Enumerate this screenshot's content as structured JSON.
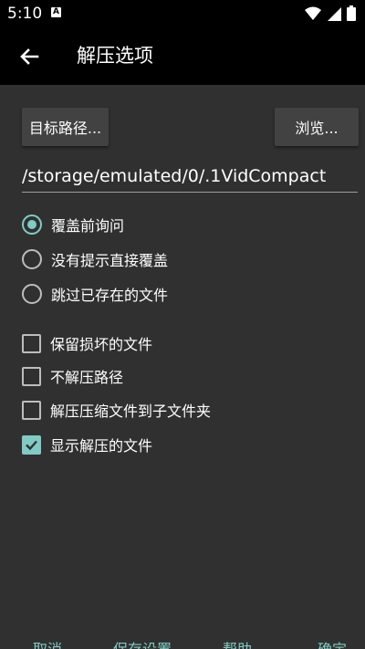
{
  "status_bar": {
    "time": "5:10",
    "notification_badge": "A",
    "icons": [
      "wifi-icon",
      "signal-icon",
      "battery-icon"
    ]
  },
  "app_bar": {
    "title": "解压选项",
    "back_icon": "arrow-left-icon"
  },
  "target_path": {
    "button_label": "目标路径...",
    "browse_label": "浏览...",
    "value": "/storage/emulated/0/.1VidCompact"
  },
  "overwrite_options": [
    {
      "label": "覆盖前询问",
      "selected": true
    },
    {
      "label": "没有提示直接覆盖",
      "selected": false
    },
    {
      "label": "跳过已存在的文件",
      "selected": false
    }
  ],
  "checkbox_options": [
    {
      "label": "保留损坏的文件",
      "checked": false
    },
    {
      "label": "不解压路径",
      "checked": false
    },
    {
      "label": "解压压缩文件到子文件夹",
      "checked": false
    },
    {
      "label": "显示解压的文件",
      "checked": true
    }
  ],
  "bottom_actions": {
    "cancel": "取消",
    "save_settings": "保存设置",
    "help": "帮助",
    "ok": "确定"
  },
  "colors": {
    "accent": "#80cbc4",
    "background": "#303030",
    "bar": "#000000"
  }
}
